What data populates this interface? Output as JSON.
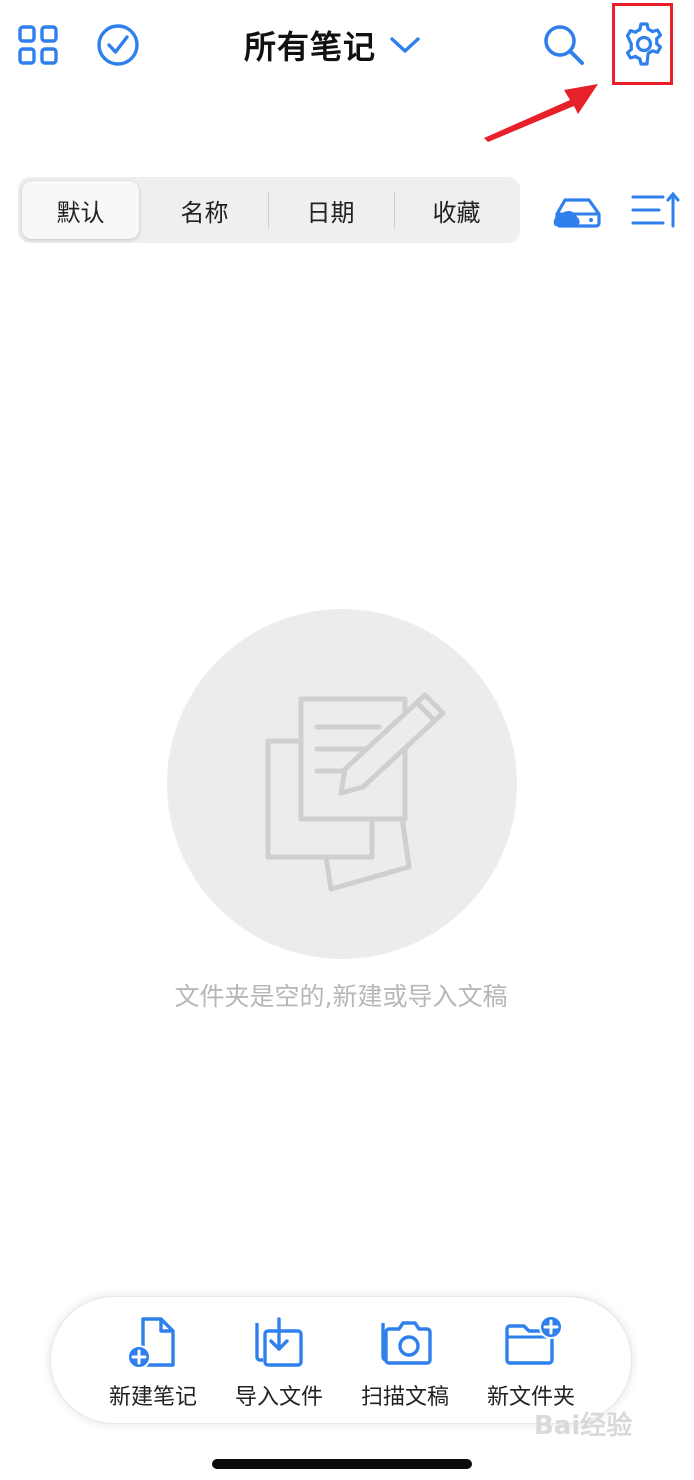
{
  "header": {
    "title": "所有笔记",
    "icons": [
      "grid-icon",
      "checkmark-circle-icon",
      "chevron-down-icon",
      "search-icon",
      "gear-icon"
    ]
  },
  "sort_tabs": [
    {
      "label": "默认",
      "active": true
    },
    {
      "label": "名称",
      "active": false
    },
    {
      "label": "日期",
      "active": false
    },
    {
      "label": "收藏",
      "active": false
    }
  ],
  "toolbar_icons": [
    "cloud-drive-icon",
    "sort-order-icon"
  ],
  "empty_state": {
    "message": "文件夹是空的,新建或导入文稿",
    "icon": "note-pencil-icon"
  },
  "bottom_actions": [
    {
      "label": "新建笔记",
      "icon": "new-note-icon"
    },
    {
      "label": "导入文件",
      "icon": "import-file-icon"
    },
    {
      "label": "扫描文稿",
      "icon": "camera-scan-icon"
    },
    {
      "label": "新文件夹",
      "icon": "new-folder-icon"
    }
  ],
  "annotation": {
    "highlight_color": "#e8202a",
    "target": "settings"
  },
  "colors": {
    "accent": "#2f80ed",
    "empty_bg": "#ececec",
    "empty_text": "#b5b7bb"
  },
  "watermark": "Bai经验"
}
